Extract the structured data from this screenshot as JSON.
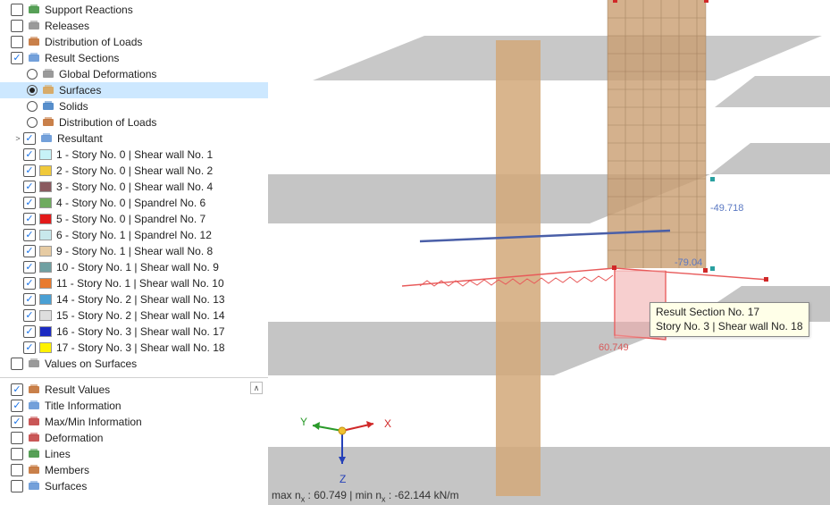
{
  "tree_top": [
    {
      "type": "check",
      "checked": false,
      "indent": 12,
      "icon": "support-icon",
      "label": "Support Reactions"
    },
    {
      "type": "check",
      "checked": false,
      "indent": 12,
      "icon": "releases-icon",
      "label": "Releases"
    },
    {
      "type": "check",
      "checked": false,
      "indent": 12,
      "icon": "distribution-icon",
      "label": "Distribution of Loads"
    },
    {
      "type": "check",
      "checked": true,
      "indent": 12,
      "icon": "resultsection-icon",
      "label": "Result Sections"
    },
    {
      "type": "radio",
      "selected": false,
      "indent": 30,
      "icon": "deform-icon",
      "label": "Global Deformations"
    },
    {
      "type": "radio",
      "selected": true,
      "indent": 30,
      "icon": "surfaces-icon",
      "label": "Surfaces",
      "sel_row": true
    },
    {
      "type": "radio",
      "selected": false,
      "indent": 30,
      "icon": "solids-icon",
      "label": "Solids"
    },
    {
      "type": "radio",
      "selected": false,
      "indent": 30,
      "icon": "distribution-icon",
      "label": "Distribution of Loads"
    },
    {
      "type": "expand",
      "exp": ">",
      "indent": 14,
      "checked": true,
      "icon": "resultant-icon",
      "label": "Resultant"
    },
    {
      "type": "check",
      "checked": true,
      "indent": 26,
      "swatch": "#c7f2f7",
      "label": "1 - Story No. 0 | Shear wall No. 1"
    },
    {
      "type": "check",
      "checked": true,
      "indent": 26,
      "swatch": "#f0c93a",
      "label": "2 - Story No. 0 | Shear wall No. 2"
    },
    {
      "type": "check",
      "checked": true,
      "indent": 26,
      "swatch": "#8a5a5f",
      "label": "3 - Story No. 0 | Shear wall No. 4"
    },
    {
      "type": "check",
      "checked": true,
      "indent": 26,
      "swatch": "#6fab5f",
      "label": "4 - Story No. 0 | Spandrel No. 6"
    },
    {
      "type": "check",
      "checked": true,
      "indent": 26,
      "swatch": "#e31a1a",
      "label": "5 - Story No. 0 | Spandrel No. 7"
    },
    {
      "type": "check",
      "checked": true,
      "indent": 26,
      "swatch": "#c8e8ec",
      "label": "6 - Story No. 1 | Spandrel No. 12"
    },
    {
      "type": "check",
      "checked": true,
      "indent": 26,
      "swatch": "#e6cba3",
      "label": "9 - Story No. 1 | Shear wall No. 8"
    },
    {
      "type": "check",
      "checked": true,
      "indent": 26,
      "swatch": "#6fa0a2",
      "label": "10 - Story No. 1 | Shear wall No. 9"
    },
    {
      "type": "check",
      "checked": true,
      "indent": 26,
      "swatch": "#e87a2e",
      "label": "11 - Story No. 1 | Shear wall No. 10"
    },
    {
      "type": "check",
      "checked": true,
      "indent": 26,
      "swatch": "#4aa0d4",
      "label": "14 - Story No. 2 | Shear wall No. 13"
    },
    {
      "type": "check",
      "checked": true,
      "indent": 26,
      "swatch": "#dedede",
      "label": "15 - Story No. 2 | Shear wall No. 14"
    },
    {
      "type": "check",
      "checked": true,
      "indent": 26,
      "swatch": "#1c2bc2",
      "label": "16 - Story No. 3 | Shear wall No. 17"
    },
    {
      "type": "check",
      "checked": true,
      "indent": 26,
      "swatch": "#fff200",
      "label": "17 - Story No. 3 | Shear wall No. 18"
    },
    {
      "type": "check",
      "checked": false,
      "indent": 12,
      "icon": "values-icon",
      "label": "Values on Surfaces"
    }
  ],
  "tree_bottom": [
    {
      "type": "check",
      "checked": true,
      "indent": 12,
      "icon": "resultvalues-icon",
      "label": "Result Values"
    },
    {
      "type": "check",
      "checked": true,
      "indent": 12,
      "icon": "title-icon",
      "label": "Title Information"
    },
    {
      "type": "check",
      "checked": true,
      "indent": 12,
      "icon": "minmax-icon",
      "label": "Max/Min Information"
    },
    {
      "type": "check",
      "checked": false,
      "indent": 12,
      "icon": "deformation-icon",
      "label": "Deformation"
    },
    {
      "type": "check",
      "checked": false,
      "indent": 12,
      "icon": "lines-icon",
      "label": "Lines"
    },
    {
      "type": "check",
      "checked": false,
      "indent": 12,
      "icon": "members-icon",
      "label": "Members"
    },
    {
      "type": "check",
      "checked": false,
      "indent": 12,
      "icon": "surfaces2-icon",
      "label": "Surfaces"
    }
  ],
  "viewport": {
    "axis": {
      "x": "X",
      "y": "Y",
      "z": "Z"
    },
    "values": {
      "top_right": "-49.718",
      "mid": "-79.04",
      "bottom": "60.749"
    },
    "tooltip": {
      "line1": "Result Section No. 17",
      "line2": "Story No. 3 | Shear wall No. 18"
    },
    "status_prefix_max": "max n",
    "status_sub": "x",
    "status_max_val": " : 60.749 | min n",
    "status_min_val": " : -62.144 kN/m"
  },
  "icons": {
    "support-icon": "#3a8f3a",
    "releases-icon": "#888",
    "distribution-icon": "#c06a2a",
    "resultsection-icon": "#5a8fd4",
    "deform-icon": "#888",
    "surfaces-icon": "#d8a050",
    "solids-icon": "#3a7ac2",
    "resultant-icon": "#5a8fd4",
    "values-icon": "#888",
    "resultvalues-icon": "#c06a2a",
    "title-icon": "#5a8fd4",
    "minmax-icon": "#c03a3a",
    "deformation-icon": "#c03a3a",
    "lines-icon": "#3a8f3a",
    "members-icon": "#c06a2a",
    "surfaces2-icon": "#5a8fd4"
  }
}
